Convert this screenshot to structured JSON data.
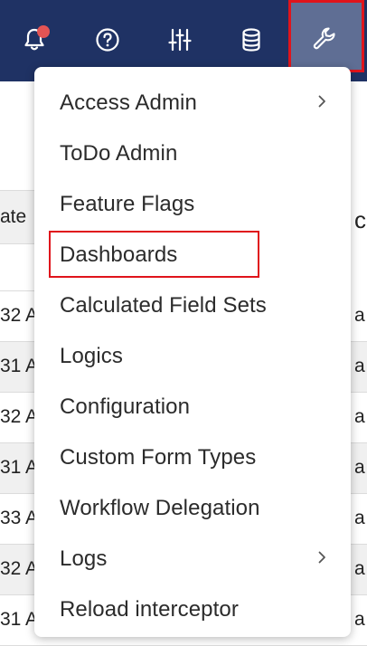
{
  "navbar": {
    "background": "#1f3264",
    "icons": [
      {
        "name": "bell-icon",
        "badge": true
      },
      {
        "name": "help-icon"
      },
      {
        "name": "sliders-icon"
      },
      {
        "name": "database-icon"
      },
      {
        "name": "wrench-icon",
        "active": true
      }
    ]
  },
  "background_table": {
    "header_fragment": "ate",
    "right_header_fragment": "c",
    "rows": [
      {
        "left": "32 A",
        "right": "a"
      },
      {
        "left": "31 A",
        "right": "a"
      },
      {
        "left": "32 A",
        "right": "a"
      },
      {
        "left": "31 A",
        "right": "a"
      },
      {
        "left": "33 A",
        "right": "a"
      },
      {
        "left": "32 A",
        "right": "a"
      },
      {
        "left": "31 A",
        "right": "a"
      }
    ]
  },
  "menu": {
    "items": [
      {
        "label": "Access Admin",
        "submenu": true
      },
      {
        "label": "ToDo Admin",
        "submenu": false
      },
      {
        "label": "Feature Flags",
        "submenu": false
      },
      {
        "label": "Dashboards",
        "submenu": false,
        "highlighted": true
      },
      {
        "label": "Calculated Field Sets",
        "submenu": false
      },
      {
        "label": "Logics",
        "submenu": false
      },
      {
        "label": "Configuration",
        "submenu": false
      },
      {
        "label": "Custom Form Types",
        "submenu": false
      },
      {
        "label": "Workflow Delegation",
        "submenu": false
      },
      {
        "label": "Logs",
        "submenu": true
      },
      {
        "label": "Reload interceptor",
        "submenu": false
      }
    ]
  },
  "colors": {
    "navbar": "#1f3264",
    "active_tool": "#5f6e94",
    "highlight_border": "#e0141b",
    "badge": "#e45454"
  }
}
